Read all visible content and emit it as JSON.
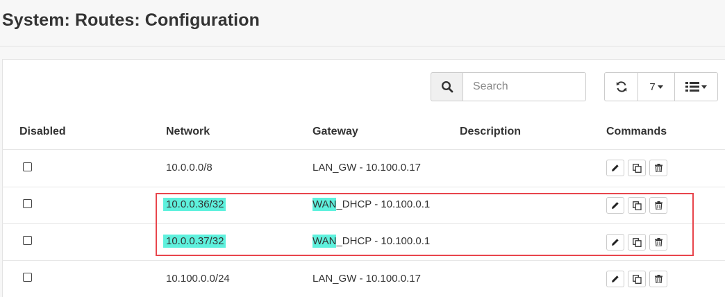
{
  "page": {
    "title": "System: Routes: Configuration"
  },
  "toolbar": {
    "search_placeholder": "Search",
    "page_size": "7"
  },
  "table": {
    "headers": {
      "disabled": "Disabled",
      "network": "Network",
      "gateway": "Gateway",
      "description": "Description",
      "commands": "Commands"
    },
    "rows": [
      {
        "disabled": false,
        "network": "10.0.0.0/8",
        "gateway_prefix": "LAN_GW - 10.100.0.17",
        "gateway_rest": "",
        "description": "",
        "highlight": false
      },
      {
        "disabled": false,
        "network": "10.0.0.36/32",
        "gateway_prefix": "WAN",
        "gateway_rest": "_DHCP - 10.100.0.1",
        "description": "",
        "highlight": true
      },
      {
        "disabled": false,
        "network": "10.0.0.37/32",
        "gateway_prefix": "WAN",
        "gateway_rest": "_DHCP - 10.100.0.1",
        "description": "",
        "highlight": true
      },
      {
        "disabled": false,
        "network": "10.100.0.0/24",
        "gateway_prefix": "LAN_GW - 10.100.0.17",
        "gateway_rest": "",
        "description": "",
        "highlight": false
      }
    ]
  },
  "colors": {
    "highlight": "#5ef1dd",
    "annotation_box": "#e8454c"
  },
  "icons": {
    "search": "search-icon",
    "refresh": "refresh-icon",
    "columns": "list-icon",
    "edit": "pencil-icon",
    "clone": "copy-icon",
    "delete": "trash-icon"
  }
}
